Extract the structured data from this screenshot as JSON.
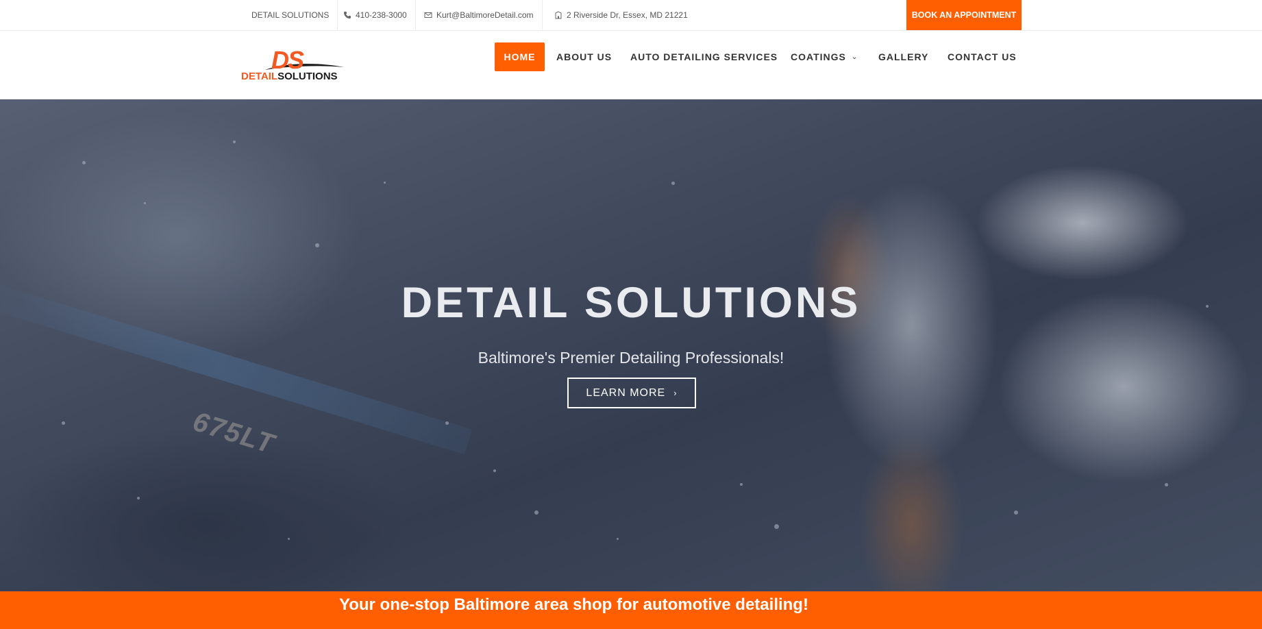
{
  "topbar": {
    "brand": "DETAIL SOLUTIONS",
    "phone": "410-238-3000",
    "email": "Kurt@BaltimoreDetail.com",
    "address": "2 Riverside Dr, Essex, MD 21221",
    "book_button": "BOOK AN APPOINTMENT",
    "icons": [
      "phone-icon",
      "envelope-icon",
      "building-icon"
    ]
  },
  "logo": {
    "mark": "DS",
    "word_part1": "DETAIL",
    "word_part2": "SOLUTIONS"
  },
  "nav": {
    "items": [
      {
        "label": "HOME",
        "active": true
      },
      {
        "label": "ABOUT US"
      },
      {
        "label": "AUTO DETAILING SERVICES"
      },
      {
        "label": "COATINGS",
        "has_dropdown": true
      },
      {
        "label": "GALLERY"
      },
      {
        "label": "CONTACT US"
      }
    ]
  },
  "hero": {
    "title": "DETAIL SOLUTIONS",
    "subtitle": "Baltimore's Premier Detailing Professionals!",
    "cta": "LEARN MORE",
    "image_text": "675LT"
  },
  "band": {
    "text": "Your one-stop Baltimore area shop for automotive detailing!"
  },
  "colors": {
    "accent": "#ff5f00",
    "text": "#333333",
    "hero_overlay": "#2f3a4f"
  }
}
